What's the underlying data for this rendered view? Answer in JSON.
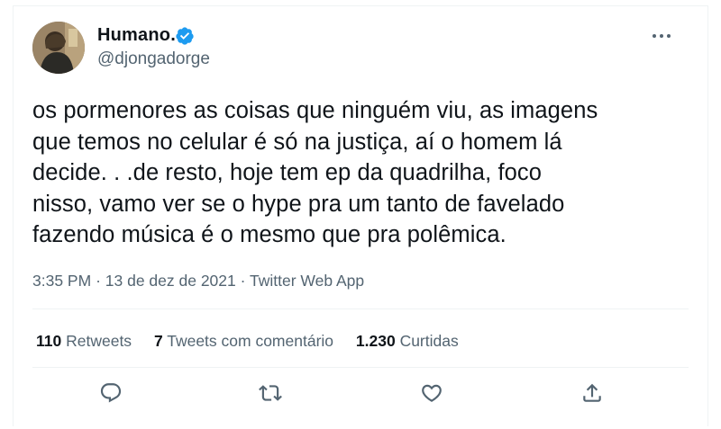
{
  "tweet": {
    "author": {
      "name": "Humano.",
      "handle": "@djongadorge",
      "verified": true
    },
    "text_lines": [
      "os pormenores as coisas que ninguém viu, as imagens",
      "que temos no celular é só na justiça, aí o homem lá",
      "decide. . .de resto, hoje tem ep da quadrilha, foco",
      "nisso, vamo ver se o hype pra um tanto de favelado",
      "fazendo música é o mesmo que pra polêmica."
    ],
    "time": "3:35 PM",
    "separator": "·",
    "date": "13 de dez de 2021",
    "source": "Twitter Web App"
  },
  "stats": {
    "retweets": {
      "count": "110",
      "label": "Retweets"
    },
    "quotes": {
      "count": "7",
      "label": "Tweets com comentário"
    },
    "likes": {
      "count": "1.230",
      "label": "Curtidas"
    }
  },
  "icons": {
    "more": "more-options-icon",
    "reply": "reply-icon",
    "retweet": "retweet-icon",
    "like": "like-icon",
    "share": "share-icon",
    "verified": "verified-badge-icon"
  },
  "colors": {
    "text": "#0f1419",
    "secondary": "#536471",
    "verified": "#1d9bf0",
    "divider": "#eff3f4"
  }
}
